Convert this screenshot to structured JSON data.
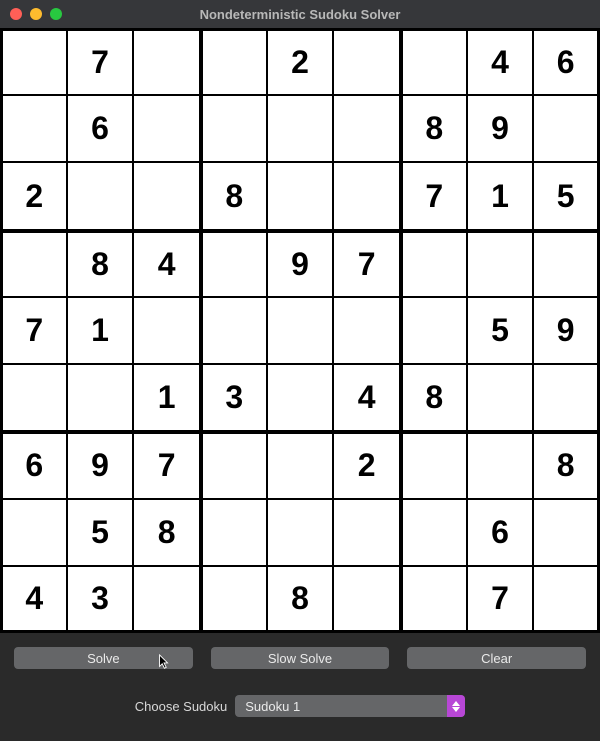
{
  "window": {
    "title": "Nondeterministic Sudoku Solver"
  },
  "board": [
    [
      "",
      "7",
      "",
      "",
      "2",
      "",
      "",
      "4",
      "6"
    ],
    [
      "",
      "6",
      "",
      "",
      "",
      "",
      "8",
      "9",
      ""
    ],
    [
      "2",
      "",
      "",
      "8",
      "",
      "",
      "7",
      "1",
      "5"
    ],
    [
      "",
      "8",
      "4",
      "",
      "9",
      "7",
      "",
      "",
      ""
    ],
    [
      "7",
      "1",
      "",
      "",
      "",
      "",
      "",
      "5",
      "9"
    ],
    [
      "",
      "",
      "1",
      "3",
      "",
      "4",
      "8",
      "",
      ""
    ],
    [
      "6",
      "9",
      "7",
      "",
      "",
      "2",
      "",
      "",
      "8"
    ],
    [
      "",
      "5",
      "8",
      "",
      "",
      "",
      "",
      "6",
      ""
    ],
    [
      "4",
      "3",
      "",
      "",
      "8",
      "",
      "",
      "7",
      ""
    ]
  ],
  "controls": {
    "solve": "Solve",
    "slow_solve": "Slow Solve",
    "clear": "Clear"
  },
  "chooser": {
    "label": "Choose Sudoku",
    "selected": "Sudoku 1"
  }
}
